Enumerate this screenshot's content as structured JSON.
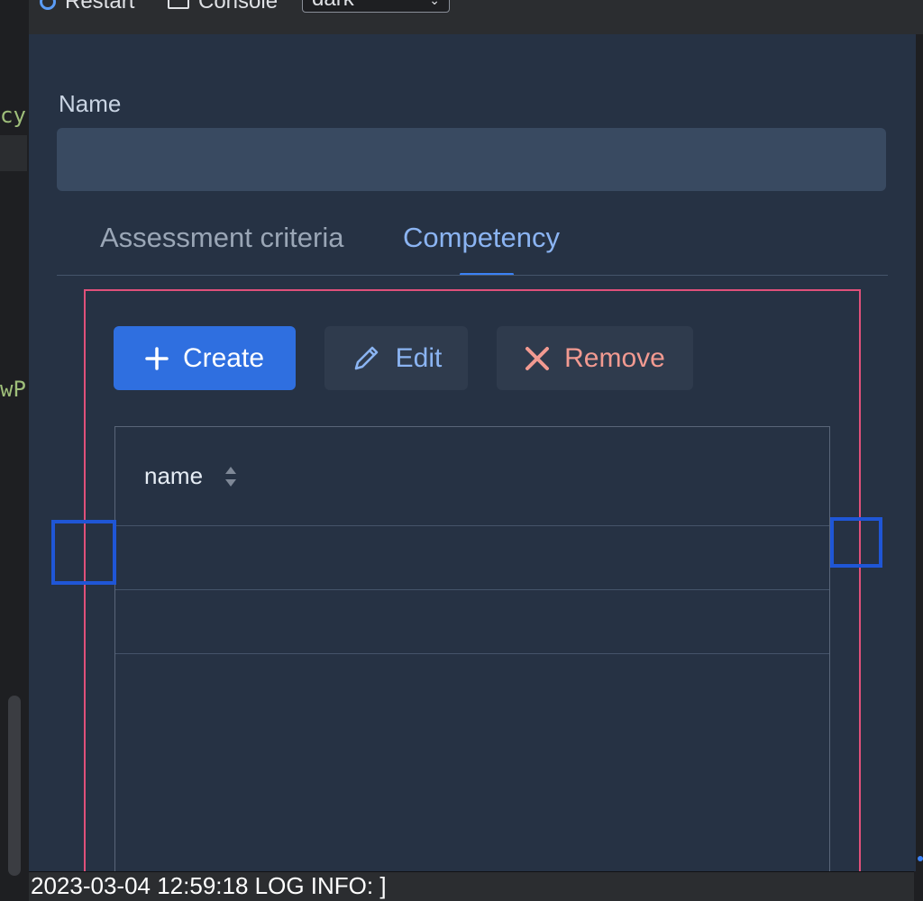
{
  "toolbar": {
    "restart_label": "Restart",
    "console_label": "Console",
    "theme_select_value": "dark"
  },
  "editor": {
    "code_fragments": [
      "cy",
      "wP"
    ]
  },
  "form": {
    "name_label": "Name",
    "name_value": "",
    "name_placeholder": ""
  },
  "tabs": [
    {
      "label": "Assessment criteria",
      "active": false
    },
    {
      "label": "Competency",
      "active": true
    }
  ],
  "actions": {
    "create_label": "Create",
    "edit_label": "Edit",
    "remove_label": "Remove"
  },
  "table": {
    "columns": [
      "name"
    ],
    "rows": []
  },
  "log": {
    "text": "2023-03-04 12:59:18 LOG INFO: ]"
  },
  "colors": {
    "panel_bg": "#263244",
    "primary": "#2f6fe0",
    "tab_active": "#8bb4f2",
    "danger_text": "#f29a91",
    "debug_frame": "#e0507a",
    "handle": "#1f56d6"
  }
}
